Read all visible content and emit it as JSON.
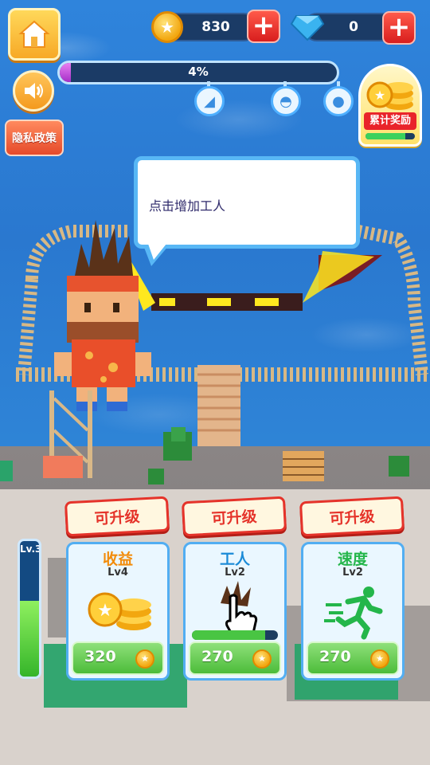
{
  "hud": {
    "coins": "830",
    "gems": "0",
    "progress_text": "4%",
    "progress_value": 0.04,
    "privacy_label": "隐私政策",
    "reward_label": "累计奖励",
    "reward_progress": 0.8
  },
  "icons": {
    "home": "home-icon",
    "sound": "speaker-icon",
    "coin": "coin-icon",
    "gem": "diamond-icon",
    "plus": "plus-icon",
    "milestones": [
      "shark-fin-icon",
      "turtle-icon",
      "balloon-icon"
    ]
  },
  "tutorial": {
    "bubble_text": "点击增加工人"
  },
  "upgrade_panel": {
    "level_label": "Lv.3",
    "level_progress": 0.56,
    "cards": [
      {
        "tag": "可升级",
        "title": "收益",
        "title_color": "#f28c0b",
        "level": "Lv4",
        "price": "320",
        "icon": "coin-stack-icon"
      },
      {
        "tag": "可升级",
        "title": "工人",
        "title_color": "#1b8bd7",
        "level": "Lv2",
        "price": "270",
        "icon": "worker-hand-icon",
        "progress": 0.85
      },
      {
        "tag": "可升级",
        "title": "速度",
        "title_color": "#24b64a",
        "level": "Lv2",
        "price": "270",
        "icon": "running-man-icon"
      }
    ]
  }
}
